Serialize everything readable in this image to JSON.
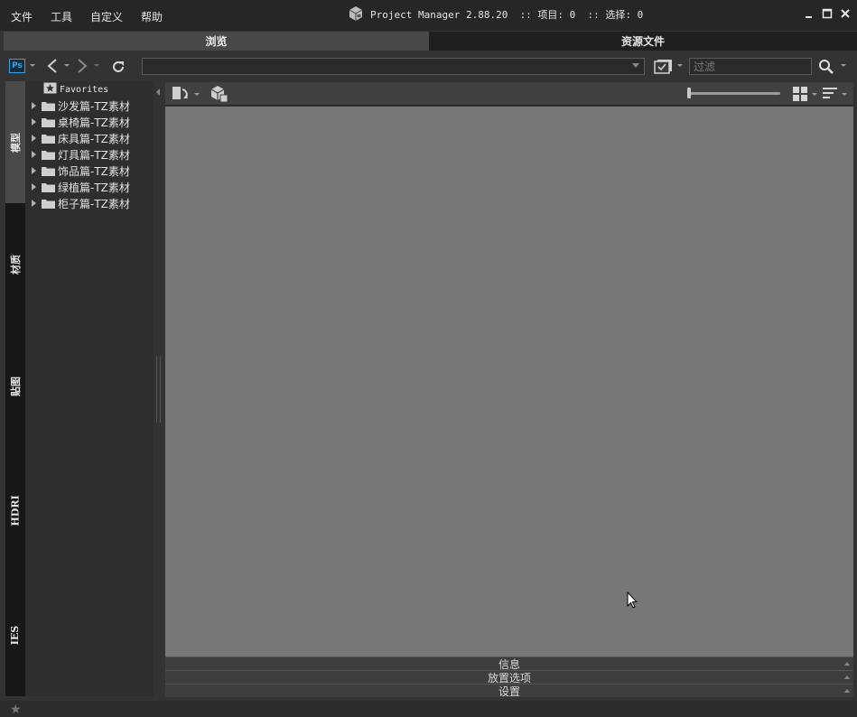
{
  "menu": {
    "file": "文件",
    "tools": "工具",
    "customize": "自定义",
    "help": "帮助"
  },
  "window": {
    "title": "Project Manager 2.88.20  :: 项目: 0  :: 选择: 0"
  },
  "tabs": {
    "browse": "浏览",
    "asset_files": "资源文件"
  },
  "toolbar": {
    "ps_label": "Ps",
    "path_value": "",
    "filter_placeholder": "过滤"
  },
  "vertical_tabs": [
    {
      "label": "模型",
      "active": true
    },
    {
      "label": "材质",
      "active": false
    },
    {
      "label": "贴图",
      "active": false
    },
    {
      "label": "HDRI",
      "active": false
    },
    {
      "label": "IES",
      "active": false
    }
  ],
  "tree": {
    "favorites": "Favorites",
    "folders": [
      "沙发篇-TZ素材",
      "桌椅篇-TZ素材",
      "床具篇-TZ素材",
      "灯具篇-TZ素材",
      "饰品篇-TZ素材",
      "绿植篇-TZ素材",
      "柜子篇-TZ素材"
    ]
  },
  "sections": {
    "info": "信息",
    "placement_options": "放置选项",
    "settings": "设置"
  },
  "colors": {
    "titlebar_bg": "#262626",
    "active_tab_bg": "#484848",
    "inactive_tab_bg": "#1f1f1f",
    "content_bg": "#777777",
    "ps_blue": "#2fa3e6"
  }
}
